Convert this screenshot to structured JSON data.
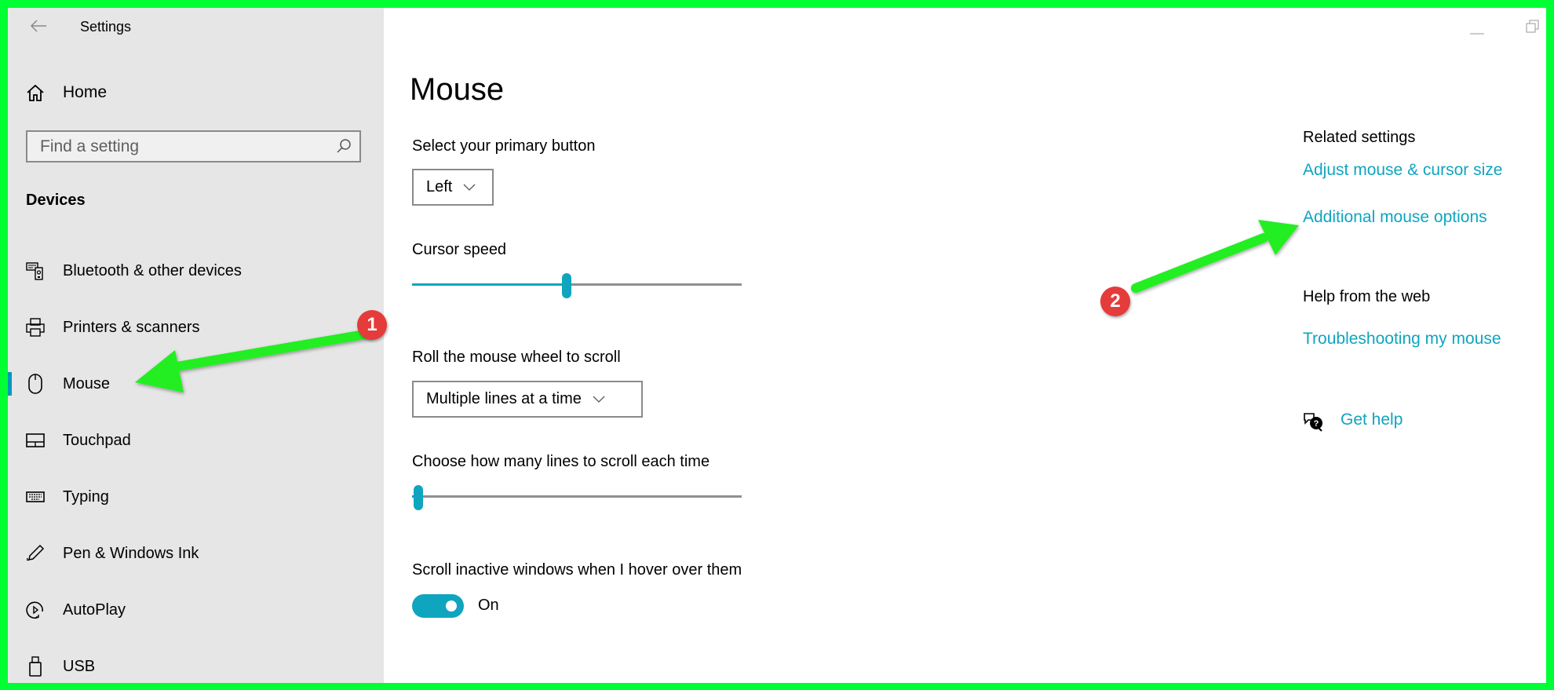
{
  "window": {
    "title": "Settings",
    "back_icon": "back-arrow-icon",
    "minimize_icon": "minimize-icon",
    "restore_icon": "restore-icon"
  },
  "sidebar": {
    "home_label": "Home",
    "search_placeholder": "Find a setting",
    "section_title": "Devices",
    "items": [
      {
        "label": "Bluetooth & other devices",
        "icon": "bluetooth-devices-icon",
        "active": false
      },
      {
        "label": "Printers & scanners",
        "icon": "printer-icon",
        "active": false
      },
      {
        "label": "Mouse",
        "icon": "mouse-icon",
        "active": true
      },
      {
        "label": "Touchpad",
        "icon": "touchpad-icon",
        "active": false
      },
      {
        "label": "Typing",
        "icon": "keyboard-icon",
        "active": false
      },
      {
        "label": "Pen & Windows Ink",
        "icon": "pen-icon",
        "active": false
      },
      {
        "label": "AutoPlay",
        "icon": "autoplay-icon",
        "active": false
      },
      {
        "label": "USB",
        "icon": "usb-icon",
        "active": false
      }
    ]
  },
  "main": {
    "title": "Mouse",
    "primary_button": {
      "label": "Select your primary button",
      "value": "Left"
    },
    "cursor_speed": {
      "label": "Cursor speed",
      "value_fraction": 0.47
    },
    "wheel_scroll": {
      "label": "Roll the mouse wheel to scroll",
      "value": "Multiple lines at a time"
    },
    "lines_to_scroll": {
      "label": "Choose how many lines to scroll each time",
      "value_fraction": 0.02
    },
    "scroll_inactive": {
      "label": "Scroll inactive windows when I hover over them",
      "state": "On",
      "enabled": true
    }
  },
  "related": {
    "heading": "Related settings",
    "links": [
      "Adjust mouse & cursor size",
      "Additional mouse options"
    ],
    "help_heading": "Help from the web",
    "help_links": [
      "Troubleshooting my mouse"
    ],
    "get_help": "Get help"
  },
  "annotations": {
    "marker_1": "1",
    "marker_2": "2",
    "arrow_color": "#22ee22",
    "marker_color": "#e53b3b"
  },
  "colors": {
    "accent": "#0fa5bf",
    "sidebar_bg": "#e6e6e6",
    "frame": "#00ff33"
  }
}
